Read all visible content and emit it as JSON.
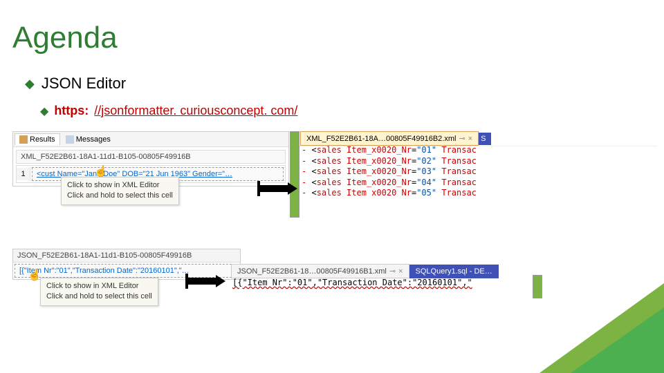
{
  "title": "Agenda",
  "bullet1": "JSON Editor",
  "bullet2": {
    "prefix": "https:",
    "link": "//jsonformatter. curiousconcept. com/"
  },
  "results": {
    "tab_results": "Results",
    "tab_messages": "Messages",
    "col_header": "XML_F52E2B61-18A1-11d1-B105-00805F49916B",
    "row_num": "1",
    "cell": "<cust Name=\"Jane Doe\" DOB=\"21 Jun 1963\" Gender=\"…"
  },
  "tooltip": {
    "line1": "Click to show in XML Editor",
    "line2": "Click and hold to select this cell"
  },
  "xml_tab": {
    "name": "XML_F52E2B61-18A…00805F49916B2.xml",
    "side": "S"
  },
  "xml_lines": [
    {
      "tag": "sales",
      "attr": "Item_x0020_Nr",
      "val": "\"01\"",
      "tail": "Transac"
    },
    {
      "tag": "sales",
      "attr": "Item_x0020_Nr",
      "val": "\"02\"",
      "tail": "Transac"
    },
    {
      "tag": "sales",
      "attr": "Item_x0020_Nr",
      "val": "\"03\"",
      "tail": "Transac"
    },
    {
      "tag": "sales",
      "attr": "Item_x0020_Nr",
      "val": "\"04\"",
      "tail": "Transac"
    },
    {
      "tag": "sales",
      "attr": "Item x0020 Nr",
      "val": "\"05\"",
      "tail": "Transac"
    }
  ],
  "json_panel": {
    "header": "JSON_F52E2B61-18A1-11d1-B105-00805F49916B",
    "cell": "[{\"Item Nr\":\"01\",\"Transaction Date\":\"20160101\",\"…"
  },
  "bottom_tabs": {
    "tab1": "JSON_F52E2B61-18…00805F49916B1.xml",
    "tab2": "SQLQuery1.sql - DE…"
  },
  "json_output": "[{\"Item Nr\":\"01\",\"Transaction Date\":\"20160101\",\""
}
